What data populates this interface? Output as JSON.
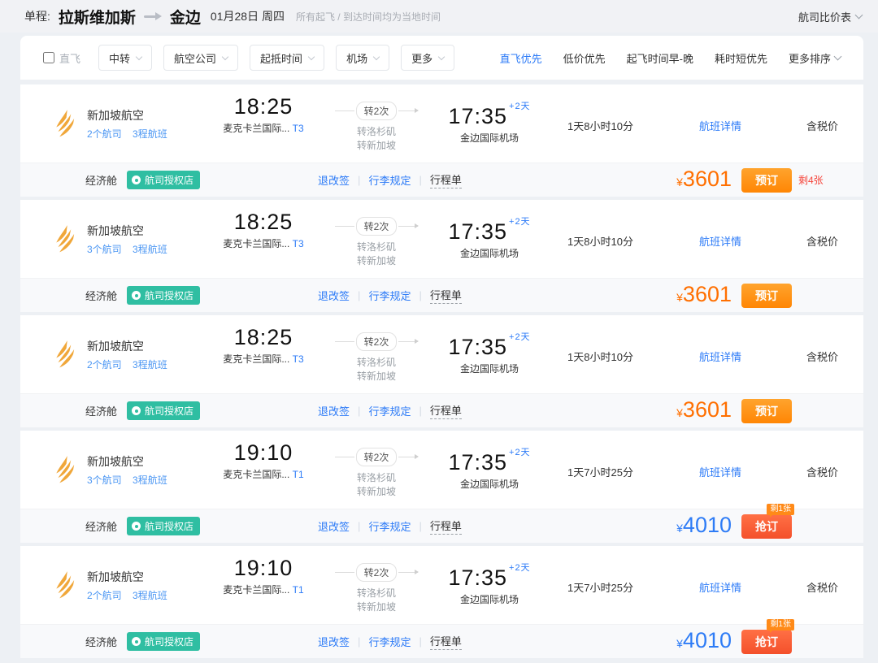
{
  "header": {
    "trip_type": "单程:",
    "origin": "拉斯维加斯",
    "destination": "金边",
    "date": "01月28日 周四",
    "note": "所有起飞 / 到达时间均为当地时间",
    "compare_link": "航司比价表"
  },
  "filters": {
    "direct_label": "直飞",
    "dropdowns": [
      "中转",
      "航空公司",
      "起抵时间",
      "机场",
      "更多"
    ],
    "sorts": [
      {
        "label": "直飞优先"
      },
      {
        "label": "低价优先"
      },
      {
        "label": "起飞时间早-晚"
      },
      {
        "label": "耗时短优先"
      },
      {
        "label": "更多排序"
      }
    ]
  },
  "flights": [
    {
      "airline": "新加坡航空",
      "carriers_link": "2个航司",
      "legs_link": "3程航班",
      "dep_time": "18:25",
      "dep_airport": "麦克卡兰国际...",
      "dep_terminal": "T3",
      "transfer_badge": "转2次",
      "transfer_1": "转洛杉矶",
      "transfer_2": "转新加坡",
      "arr_time": "17:35",
      "arr_days": "+2天",
      "arr_airport": "金边国际机场",
      "duration": "1天8小时10分",
      "details_link": "航班详情",
      "tax_label": "含税价",
      "cabin": "经济舱",
      "shop_badge": "航司授权店",
      "refund_link": "退改签",
      "baggage_link": "行李规定",
      "itinerary_link": "行程单",
      "currency": "¥",
      "price": "3601",
      "price_color": "orange",
      "button_label": "预订",
      "button_style": "book",
      "seats_note": "剩4张",
      "seats_tag": ""
    },
    {
      "airline": "新加坡航空",
      "carriers_link": "3个航司",
      "legs_link": "3程航班",
      "dep_time": "18:25",
      "dep_airport": "麦克卡兰国际...",
      "dep_terminal": "T3",
      "transfer_badge": "转2次",
      "transfer_1": "转洛杉矶",
      "transfer_2": "转新加坡",
      "arr_time": "17:35",
      "arr_days": "+2天",
      "arr_airport": "金边国际机场",
      "duration": "1天8小时10分",
      "details_link": "航班详情",
      "tax_label": "含税价",
      "cabin": "经济舱",
      "shop_badge": "航司授权店",
      "refund_link": "退改签",
      "baggage_link": "行李规定",
      "itinerary_link": "行程单",
      "currency": "¥",
      "price": "3601",
      "price_color": "orange",
      "button_label": "预订",
      "button_style": "book",
      "seats_note": "",
      "seats_tag": ""
    },
    {
      "airline": "新加坡航空",
      "carriers_link": "2个航司",
      "legs_link": "3程航班",
      "dep_time": "18:25",
      "dep_airport": "麦克卡兰国际...",
      "dep_terminal": "T3",
      "transfer_badge": "转2次",
      "transfer_1": "转洛杉矶",
      "transfer_2": "转新加坡",
      "arr_time": "17:35",
      "arr_days": "+2天",
      "arr_airport": "金边国际机场",
      "duration": "1天8小时10分",
      "details_link": "航班详情",
      "tax_label": "含税价",
      "cabin": "经济舱",
      "shop_badge": "航司授权店",
      "refund_link": "退改签",
      "baggage_link": "行李规定",
      "itinerary_link": "行程单",
      "currency": "¥",
      "price": "3601",
      "price_color": "orange",
      "button_label": "预订",
      "button_style": "book",
      "seats_note": "",
      "seats_tag": ""
    },
    {
      "airline": "新加坡航空",
      "carriers_link": "3个航司",
      "legs_link": "3程航班",
      "dep_time": "19:10",
      "dep_airport": "麦克卡兰国际...",
      "dep_terminal": "T1",
      "transfer_badge": "转2次",
      "transfer_1": "转洛杉矶",
      "transfer_2": "转新加坡",
      "arr_time": "17:35",
      "arr_days": "+2天",
      "arr_airport": "金边国际机场",
      "duration": "1天7小时25分",
      "details_link": "航班详情",
      "tax_label": "含税价",
      "cabin": "经济舱",
      "shop_badge": "航司授权店",
      "refund_link": "退改签",
      "baggage_link": "行李规定",
      "itinerary_link": "行程单",
      "currency": "¥",
      "price": "4010",
      "price_color": "blue",
      "button_label": "抢订",
      "button_style": "grab",
      "seats_note": "",
      "seats_tag": "剩1张"
    },
    {
      "airline": "新加坡航空",
      "carriers_link": "2个航司",
      "legs_link": "3程航班",
      "dep_time": "19:10",
      "dep_airport": "麦克卡兰国际...",
      "dep_terminal": "T1",
      "transfer_badge": "转2次",
      "transfer_1": "转洛杉矶",
      "transfer_2": "转新加坡",
      "arr_time": "17:35",
      "arr_days": "+2天",
      "arr_airport": "金边国际机场",
      "duration": "1天7小时25分",
      "details_link": "航班详情",
      "tax_label": "含税价",
      "cabin": "经济舱",
      "shop_badge": "航司授权店",
      "refund_link": "退改签",
      "baggage_link": "行李规定",
      "itinerary_link": "行程单",
      "currency": "¥",
      "price": "4010",
      "price_color": "blue",
      "button_label": "抢订",
      "button_style": "grab",
      "seats_note": "",
      "seats_tag": "剩1张"
    }
  ]
}
